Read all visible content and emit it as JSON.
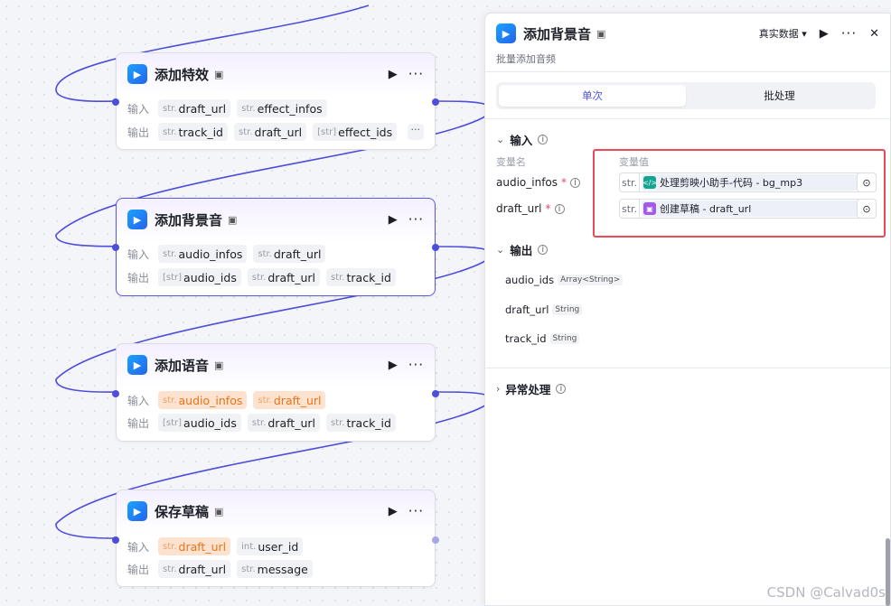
{
  "nodes": [
    {
      "title": "添加特效",
      "input_label": "输入",
      "output_label": "输出",
      "inputs": [
        {
          "type": "str.",
          "name": "draft_url"
        },
        {
          "type": "str.",
          "name": "effect_infos"
        }
      ],
      "outputs": [
        {
          "type": "str.",
          "name": "track_id"
        },
        {
          "type": "str.",
          "name": "draft_url"
        },
        {
          "type": "[str]",
          "name": "effect_ids"
        }
      ]
    },
    {
      "title": "添加背景音",
      "input_label": "输入",
      "output_label": "输出",
      "inputs": [
        {
          "type": "str.",
          "name": "audio_infos"
        },
        {
          "type": "str.",
          "name": "draft_url"
        }
      ],
      "outputs": [
        {
          "type": "[str]",
          "name": "audio_ids"
        },
        {
          "type": "str.",
          "name": "draft_url"
        },
        {
          "type": "str.",
          "name": "track_id"
        }
      ]
    },
    {
      "title": "添加语音",
      "input_label": "输入",
      "output_label": "输出",
      "inputs": [
        {
          "type": "str.",
          "name": "audio_infos"
        },
        {
          "type": "str.",
          "name": "draft_url"
        }
      ],
      "outputs": [
        {
          "type": "[str]",
          "name": "audio_ids"
        },
        {
          "type": "str.",
          "name": "draft_url"
        },
        {
          "type": "str.",
          "name": "track_id"
        }
      ]
    },
    {
      "title": "保存草稿",
      "input_label": "输入",
      "output_label": "输出",
      "inputs": [
        {
          "type": "str.",
          "name": "draft_url"
        },
        {
          "type": "int.",
          "name": "user_id"
        }
      ],
      "outputs": [
        {
          "type": "str.",
          "name": "draft_url"
        },
        {
          "type": "str.",
          "name": "message"
        }
      ]
    }
  ],
  "panel": {
    "title": "添加背景音",
    "subtitle": "批量添加音频",
    "data_mode": "真实数据",
    "tabs": [
      "单次",
      "批处理"
    ],
    "input_section": "输入",
    "col_name": "变量名",
    "col_value": "变量值",
    "params": [
      {
        "name": "audio_infos",
        "type": "str.",
        "ref": "处理剪映小助手-代码 - bg_mp3"
      },
      {
        "name": "draft_url",
        "type": "str.",
        "ref": "创建草稿 - draft_url"
      }
    ],
    "output_section": "输出",
    "outputs": [
      {
        "name": "audio_ids",
        "type": "Array<String>"
      },
      {
        "name": "draft_url",
        "type": "String"
      },
      {
        "name": "track_id",
        "type": "String"
      }
    ],
    "exception_section": "异常处理"
  },
  "watermark": "CSDN @Calvad0s",
  "colors": {
    "accent": "#4d53e8",
    "edge": "#4f4ed9",
    "highlight": "#e94a55",
    "orange": "#e8741a"
  },
  "icons": [
    "app-icon",
    "play-icon",
    "more-icon",
    "close-icon",
    "chevron-down-icon",
    "chevron-right-icon",
    "info-icon",
    "code-icon",
    "box-icon",
    "target-icon"
  ]
}
